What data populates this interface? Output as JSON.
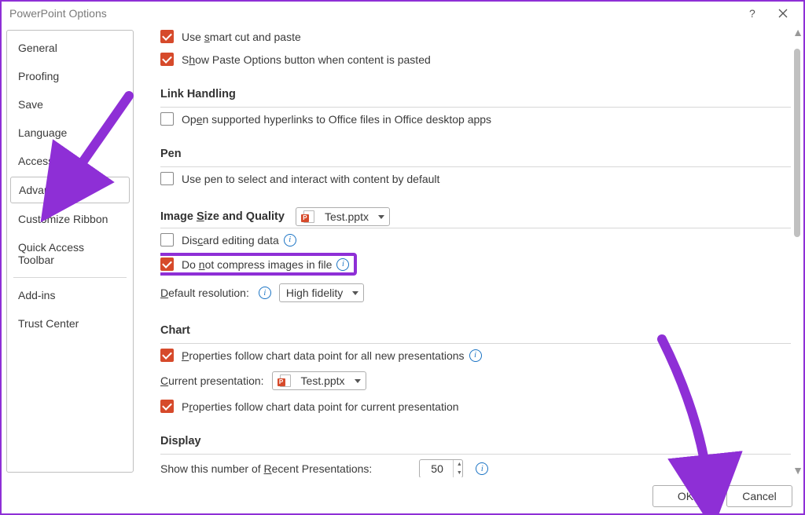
{
  "title": "PowerPoint Options",
  "sidebar": {
    "items": [
      {
        "label": "General"
      },
      {
        "label": "Proofing"
      },
      {
        "label": "Save"
      },
      {
        "label": "Language"
      },
      {
        "label": "Accessibility"
      },
      {
        "label": "Advanced"
      },
      {
        "label": "Customize Ribbon"
      },
      {
        "label": "Quick Access Toolbar"
      },
      {
        "label": "Add-ins"
      },
      {
        "label": "Trust Center"
      }
    ],
    "selected": 5
  },
  "content": {
    "cb_smart_cut": "Use smart cut and paste",
    "cb_paste_options": "Show Paste Options button when content is pasted",
    "sec_link": "Link Handling",
    "cb_open_hyperlinks": "Open supported hyperlinks to Office files in Office desktop apps",
    "sec_pen": "Pen",
    "cb_pen_default": "Use pen to select and interact with content by default",
    "sec_image": "Image Size and Quality",
    "file_name": "Test.pptx",
    "cb_discard": "Discard editing data",
    "cb_no_compress": "Do not compress images in file",
    "default_res_label": "Default resolution:",
    "default_res_value": "High fidelity",
    "sec_chart": "Chart",
    "cb_chart_all": "Properties follow chart data point for all new presentations",
    "current_pres_label": "Current presentation:",
    "cb_chart_current": "Properties follow chart data point for current presentation",
    "sec_display": "Display",
    "recent_label": "Show this number of Recent Presentations:",
    "recent_value": "50"
  },
  "footer": {
    "ok": "OK",
    "cancel": "Cancel"
  }
}
